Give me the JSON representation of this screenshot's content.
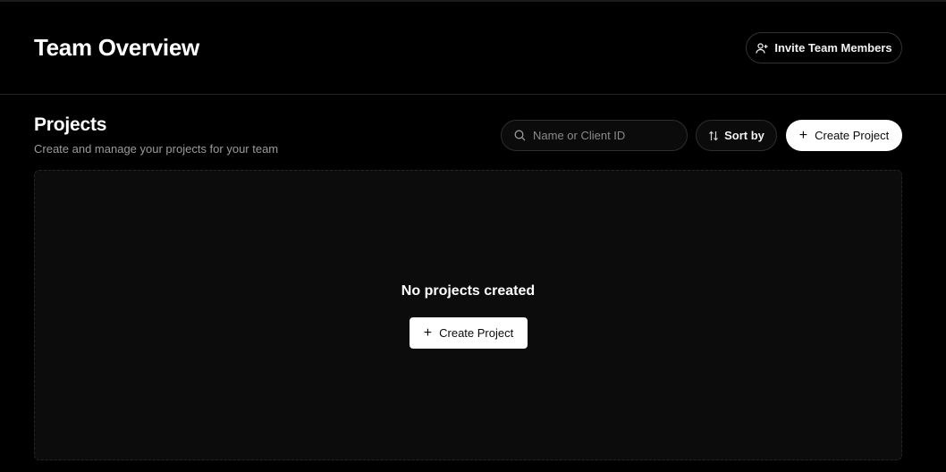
{
  "header": {
    "title": "Team Overview",
    "invite_label": "Invite Team Members",
    "invite_icon": "user-plus-icon"
  },
  "projects": {
    "title": "Projects",
    "subtitle": "Create and manage your projects for your team",
    "search": {
      "placeholder": "Name or Client ID",
      "value": "",
      "icon": "search-icon"
    },
    "sort_label": "Sort by",
    "sort_icon": "sort-arrows-icon",
    "create_label": "Create Project",
    "empty_state": {
      "title": "No projects created",
      "create_label": "Create Project"
    }
  },
  "colors": {
    "background": "#000000",
    "panel": "#0c0c0c",
    "border": "#2e2e2e",
    "primary_button": "#ffffff",
    "muted_text": "#9a9a9a"
  }
}
